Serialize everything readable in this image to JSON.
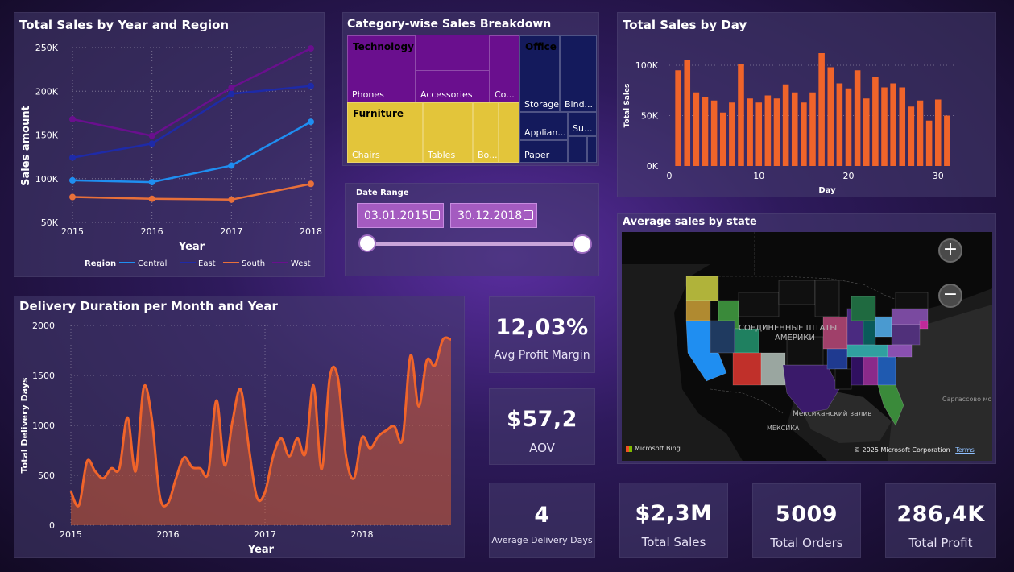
{
  "colors": {
    "central": "#1f8ef1",
    "east": "#1e2aa8",
    "south": "#e8703a",
    "west": "#6a0f8e",
    "orange": "#f0642a",
    "technology": "#6a0f8e",
    "furniture": "#e3c53a",
    "office": "#141a5c"
  },
  "line_chart": {
    "title": "Total Sales by Year and Region",
    "ylabel": "Sales amount",
    "xlabel": "Year",
    "y_ticks": [
      "250K",
      "200K",
      "150K",
      "100K",
      "50K"
    ],
    "x_ticks": [
      "2015",
      "2016",
      "2017",
      "2018"
    ],
    "legend_title": "Region",
    "legend": [
      "Central",
      "East",
      "South",
      "West"
    ]
  },
  "treemap": {
    "title": "Category-wise Sales Breakdown",
    "technology": "Technology",
    "furniture": "Furniture",
    "office": "Office Supp...",
    "phones": "Phones",
    "accessories": "Accessories",
    "copiers": "Co...",
    "chairs": "Chairs",
    "tables": "Tables",
    "bookcases": "Bo...",
    "storage": "Storage",
    "binders": "Bind...",
    "appliances": "Applian...",
    "supplies": "Su...",
    "paper": "Paper"
  },
  "bar_chart": {
    "title": "Total Sales by Day",
    "ylabel": "Total Sales",
    "xlabel": "Day",
    "y_ticks": [
      "100K",
      "50K",
      "0K"
    ],
    "x_ticks": [
      "0",
      "10",
      "20",
      "30"
    ]
  },
  "date_range": {
    "title": "Date Range",
    "start": "03.01.2015",
    "end": "30.12.2018"
  },
  "map": {
    "title": "Average sales by state",
    "label_country": "СОЕДИНЕННЫЕ ШТАТЫ",
    "label_country2": "АМЕРИКИ",
    "label_gulf": "Мексиканский залив",
    "label_mexico": "МЕКСИКА",
    "label_sargasso": "Саргассово море",
    "bing": "Microsoft Bing",
    "copyright": "© 2025 Microsoft Corporation",
    "terms": "Terms",
    "zoom_in": "+",
    "zoom_out": "−"
  },
  "area_chart": {
    "title": "Delivery Duration per Month and Year",
    "ylabel": "Total Delivery Days",
    "xlabel": "Year",
    "y_ticks": [
      "2000",
      "1500",
      "1000",
      "500",
      "0"
    ],
    "x_ticks": [
      "2015",
      "2016",
      "2017",
      "2018"
    ]
  },
  "kpis": {
    "profit_margin": {
      "value": "12,03%",
      "label": "Avg Profit Margin"
    },
    "aov": {
      "value": "$57,2",
      "label": "AOV"
    },
    "delivery_days": {
      "value": "4",
      "label": "Average Delivery Days"
    },
    "total_sales": {
      "value": "$2,3M",
      "label": "Total Sales"
    },
    "total_orders": {
      "value": "5009",
      "label": "Total Orders"
    },
    "total_profit": {
      "value": "286,4K",
      "label": "Total Profit"
    }
  },
  "chart_data": [
    {
      "type": "line",
      "title": "Total Sales by Year and Region",
      "xlabel": "Year",
      "ylabel": "Sales amount",
      "x": [
        2015,
        2016,
        2017,
        2018
      ],
      "ylim": [
        50000,
        250000
      ],
      "legend": "bottom",
      "series": [
        {
          "name": "Central",
          "values": [
            98000,
            96000,
            115000,
            165000
          ]
        },
        {
          "name": "East",
          "values": [
            124000,
            140000,
            197000,
            206000
          ]
        },
        {
          "name": "South",
          "values": [
            79000,
            77000,
            76000,
            94000
          ]
        },
        {
          "name": "West",
          "values": [
            168000,
            149000,
            204000,
            249000
          ]
        }
      ]
    },
    {
      "type": "bar",
      "title": "Total Sales by Day",
      "xlabel": "Day",
      "ylabel": "Total Sales",
      "x": [
        1,
        2,
        3,
        4,
        5,
        6,
        7,
        8,
        9,
        10,
        11,
        12,
        13,
        14,
        15,
        16,
        17,
        18,
        19,
        20,
        21,
        22,
        23,
        24,
        25,
        26,
        27,
        28,
        29,
        30,
        31
      ],
      "values": [
        95000,
        105000,
        73000,
        68000,
        65000,
        53000,
        63000,
        101000,
        67000,
        63000,
        70000,
        67000,
        81000,
        73000,
        63000,
        73000,
        112000,
        98000,
        82000,
        77000,
        95000,
        67000,
        88000,
        78000,
        82000,
        78000,
        59000,
        65000,
        45000,
        66000,
        50000
      ],
      "ylim": [
        0,
        120000
      ],
      "grid": true
    },
    {
      "type": "area",
      "title": "Delivery Duration per Month and Year",
      "xlabel": "Year",
      "ylabel": "Total Delivery Days",
      "x": [
        "2015-01",
        "2015-02",
        "2015-03",
        "2015-04",
        "2015-05",
        "2015-06",
        "2015-07",
        "2015-08",
        "2015-09",
        "2015-10",
        "2015-11",
        "2015-12",
        "2016-01",
        "2016-02",
        "2016-03",
        "2016-04",
        "2016-05",
        "2016-06",
        "2016-07",
        "2016-08",
        "2016-09",
        "2016-10",
        "2016-11",
        "2016-12",
        "2017-01",
        "2017-02",
        "2017-03",
        "2017-04",
        "2017-05",
        "2017-06",
        "2017-07",
        "2017-08",
        "2017-09",
        "2017-10",
        "2017-11",
        "2017-12",
        "2018-01",
        "2018-02",
        "2018-03",
        "2018-04",
        "2018-05",
        "2018-06",
        "2018-07",
        "2018-08",
        "2018-09",
        "2018-10",
        "2018-11",
        "2018-12"
      ],
      "values": [
        340,
        200,
        640,
        540,
        470,
        570,
        570,
        1080,
        540,
        1380,
        1070,
        290,
        220,
        470,
        680,
        580,
        570,
        530,
        1250,
        600,
        1050,
        1360,
        780,
        280,
        330,
        690,
        870,
        690,
        870,
        720,
        1400,
        560,
        1480,
        1480,
        700,
        470,
        880,
        770,
        890,
        950,
        990,
        860,
        1700,
        1190,
        1650,
        1600,
        1860,
        1860
      ],
      "ylim": [
        0,
        2000
      ],
      "grid": true
    }
  ]
}
